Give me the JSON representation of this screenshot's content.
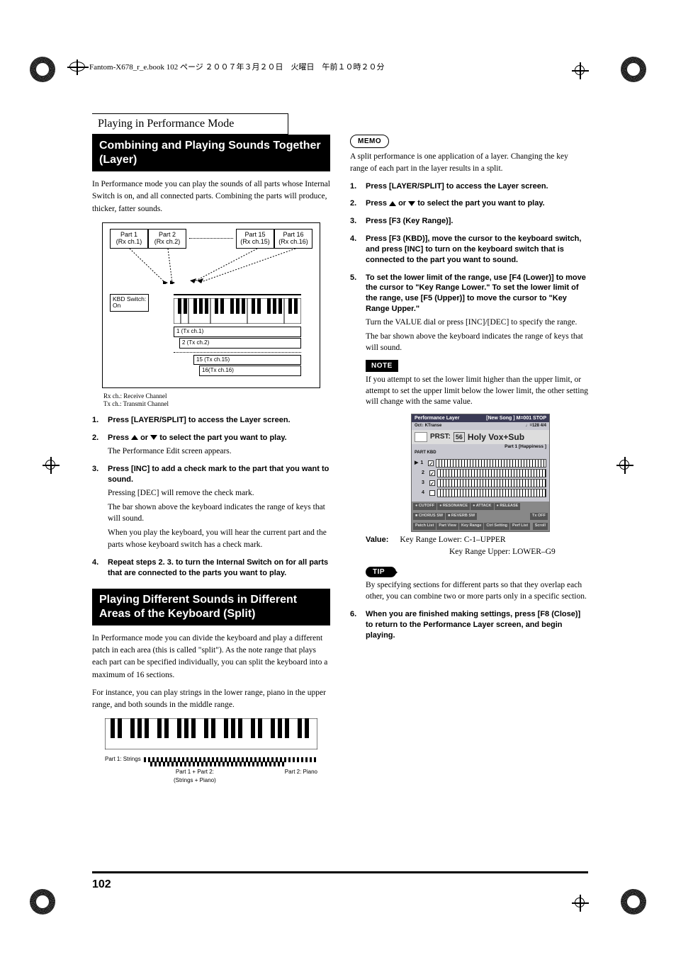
{
  "book_header": "Fantom-X678_r_e.book  102 ページ  ２００７年３月２０日　火曜日　午前１０時２０分",
  "chapter_title": "Playing in Performance Mode",
  "page_number": "102",
  "left": {
    "section1_title": "Combining and Playing Sounds Together (Layer)",
    "section1_intro": "In Performance mode you can play the sounds of all parts whose Internal Switch is on, and all connected parts. Combining the parts will produce, thicker, fatter sounds.",
    "diag": {
      "parts": [
        "Part 1",
        "Part 2",
        "Part 15",
        "Part 16"
      ],
      "parts_sub": [
        "(Rx ch.1)",
        "(Rx ch.2)",
        "(Rx ch.15)",
        "(Rx ch.16)"
      ],
      "kbd_switch": "KBD Switch:",
      "kbd_on": "On",
      "tx": [
        "1 (Tx ch.1)",
        "2 (Tx ch.2)",
        "15 (Tx ch.15)",
        "16(Tx ch.16)"
      ],
      "caption1": "Rx ch.: Receive Channel",
      "caption2": "Tx ch.: Transmit Channel"
    },
    "steps": {
      "s1": "Press [LAYER/SPLIT] to access the Layer screen.",
      "s2a": "Press ",
      "s2b": " or ",
      "s2c": " to select the part you want to play.",
      "s2_body": "The Performance Edit screen appears.",
      "s3": "Press [INC] to add a check mark to the part that you want to sound.",
      "s3_body1": "Pressing [DEC] will remove the check mark.",
      "s3_body2": "The bar shown above the keyboard indicates the range of keys that will sound.",
      "s3_body3": "When you play the keyboard, you will hear the current part and the parts whose keyboard switch has a check mark.",
      "s4": "Repeat steps 2. 3. to turn the Internal Switch on for all parts that are connected to the parts you want to play."
    },
    "section2_title": "Playing Different Sounds in Different Areas of the Keyboard (Split)",
    "section2_p1": "In Performance mode you can divide the keyboard and play a different patch in each area (this is called \"split\"). As the note range that plays each part can be specified individually, you can split the keyboard into a maximum of 16 sections.",
    "section2_p2": "For instance, you can play strings in the lower range, piano in the upper range, and both sounds in the middle range.",
    "split": {
      "left": "Part 1: Strings",
      "mid": "Part 1 + Part 2:\n(Strings + Piano)",
      "right": "Part 2: Piano"
    }
  },
  "right": {
    "memo_label": "MEMO",
    "memo_text": "A split performance is one application of a layer. Changing the key range of each part in the layer results in a split.",
    "steps": {
      "s1": "Press [LAYER/SPLIT] to access the Layer screen.",
      "s2a": "Press ",
      "s2b": " or ",
      "s2c": " to select the part you want to play.",
      "s3": "Press [F3 (Key Range)].",
      "s4": "Press [F3 (KBD)], move the cursor to the keyboard switch, and press [INC] to turn on the keyboard switch that is connected to the part you want to sound.",
      "s5": "To set the lower limit of the range, use [F4 (Lower)] to move the cursor to \"Key Range Lower.\" To set the lower limit of the range, use [F5 (Upper)] to move the cursor to \"Key Range Upper.\"",
      "s5_body1": "Turn the VALUE dial or press [INC]/[DEC] to specify the range.",
      "s5_body2": "The bar shown above the keyboard indicates the range of keys that will sound.",
      "s6": "When you are finished making settings, press [F8 (Close)] to return to the Performance Layer screen, and begin playing."
    },
    "note_label": "NOTE",
    "note_text": "If you attempt to set the lower limit higher than the upper limit, or attempt to set the upper limit below the lower limit, the other setting will change with the same value.",
    "screenshot": {
      "title_l": "Performance Layer",
      "title_r": "[New Song       ] M=001 STOP",
      "sub_l": "Oct↕ KTranse",
      "sub_r": "♩=128   4/4",
      "prst_label": "PRST:",
      "prst_num": "56",
      "prst_name": "Holy Vox+Sub",
      "part_line": "Part  1   [Happiness        ]",
      "col_hdr": "PART KBD",
      "rows": [
        "1",
        "2",
        "3",
        "4"
      ],
      "knobs": [
        "● CUTOFF",
        "● RESONANCE",
        "● ATTACK",
        "● RELEASE"
      ],
      "switches": [
        "■ CHORUS SW",
        "■ REVERB SW"
      ],
      "tx": "Tx OFF",
      "btns": [
        "Patch List",
        "Part View",
        "Key Range",
        "Ctrl Setting",
        "Perf List"
      ],
      "scroll": "Scroll"
    },
    "value_label": "Value:",
    "value1": "Key Range Lower: C-1–UPPER",
    "value2": "Key Range Upper: LOWER–G9",
    "tip_label": "TIP",
    "tip_text": "By specifying sections for different parts so that they overlap each other, you can combine two or more parts only in a specific section."
  }
}
